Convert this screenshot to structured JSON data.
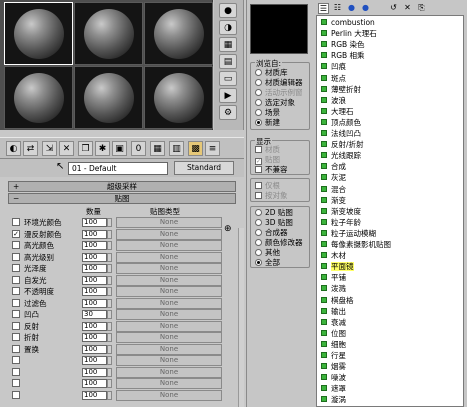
{
  "toolbar": {
    "material_name": "01 - Default",
    "type_button": "Standard"
  },
  "rollouts": {
    "supersampling": "超级采样",
    "maps": "贴图"
  },
  "maps_header": {
    "amount": "数量",
    "map_type": "贴图类型"
  },
  "map_slots": [
    {
      "label": "环境光颜色",
      "amount": "100",
      "checked": false,
      "map": "None"
    },
    {
      "label": "漫反射颜色",
      "amount": "100",
      "checked": true,
      "map": "None"
    },
    {
      "label": "高光颜色",
      "amount": "100",
      "checked": false,
      "map": "None"
    },
    {
      "label": "高光级别",
      "amount": "100",
      "checked": false,
      "map": "None"
    },
    {
      "label": "光泽度",
      "amount": "100",
      "checked": false,
      "map": "None"
    },
    {
      "label": "自发光",
      "amount": "100",
      "checked": false,
      "map": "None"
    },
    {
      "label": "不透明度",
      "amount": "100",
      "checked": false,
      "map": "None"
    },
    {
      "label": "过滤色",
      "amount": "100",
      "checked": false,
      "map": "None"
    },
    {
      "label": "凹凸",
      "amount": "30",
      "checked": false,
      "map": "None"
    },
    {
      "label": "反射",
      "amount": "100",
      "checked": false,
      "map": "None"
    },
    {
      "label": "折射",
      "amount": "100",
      "checked": false,
      "map": "None"
    },
    {
      "label": "置换",
      "amount": "100",
      "checked": false,
      "map": "None"
    },
    {
      "label": "",
      "amount": "100",
      "checked": false,
      "map": "None"
    },
    {
      "label": "",
      "amount": "100",
      "checked": false,
      "map": "None"
    },
    {
      "label": "",
      "amount": "100",
      "checked": false,
      "map": "None"
    },
    {
      "label": "",
      "amount": "100",
      "checked": false,
      "map": "None"
    }
  ],
  "browse_from": {
    "title": "浏览自:",
    "options": [
      {
        "label": "材质库",
        "on": false,
        "dim": false
      },
      {
        "label": "材质编辑器",
        "on": false,
        "dim": false
      },
      {
        "label": "活动示例窗",
        "on": false,
        "dim": true
      },
      {
        "label": "选定对象",
        "on": false,
        "dim": false
      },
      {
        "label": "场景",
        "on": false,
        "dim": false
      },
      {
        "label": "新建",
        "on": true,
        "dim": false
      }
    ]
  },
  "show": {
    "title": "显示",
    "options": [
      {
        "label": "材质",
        "checked": false,
        "dim": true
      },
      {
        "label": "贴图",
        "checked": true,
        "dim": true
      },
      {
        "label": "不兼容",
        "checked": false,
        "dim": false
      }
    ]
  },
  "root_only": {
    "options": [
      {
        "label": "仅根",
        "dim": true
      },
      {
        "label": "按对象",
        "dim": true
      }
    ]
  },
  "map_filter": {
    "options": [
      {
        "label": "2D 贴图",
        "on": false
      },
      {
        "label": "3D 贴图",
        "on": false
      },
      {
        "label": "合成器",
        "on": false
      },
      {
        "label": "颜色修改器",
        "on": false
      },
      {
        "label": "其他",
        "on": false
      },
      {
        "label": "全部",
        "on": true
      }
    ]
  },
  "map_list": [
    "combustion",
    "Perlin 大理石",
    "RGB 染色",
    "RGB 相乘",
    "凹痕",
    "斑点",
    "薄壁折射",
    "波浪",
    "大理石",
    "顶点颜色",
    "法线凹凸",
    "反射/折射",
    "光线跟踪",
    "合成",
    "灰泥",
    "混合",
    "渐变",
    "渐变坡度",
    "粒子年龄",
    "粒子运动模糊",
    "每像素摄影机贴图",
    "木材",
    "平面镜",
    "平铺",
    "泼溅",
    "棋盘格",
    "输出",
    "衰减",
    "位图",
    "细胞",
    "行星",
    "烟雾",
    "噪波",
    "遮罩",
    "漩涡"
  ],
  "map_list_selected": "平面镜"
}
